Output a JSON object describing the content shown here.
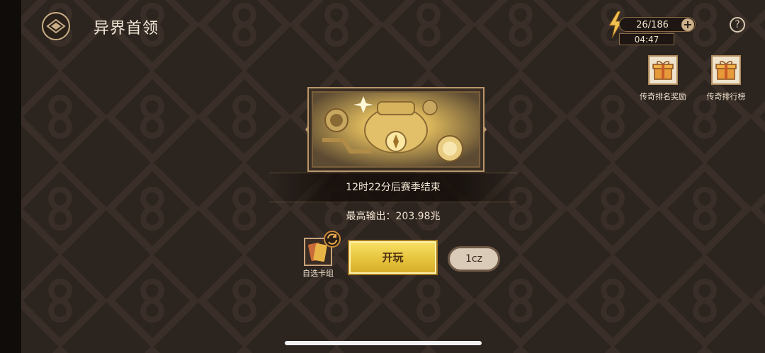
{
  "header": {
    "title": "异界首领"
  },
  "energy": {
    "count": "26/186",
    "timer": "04:47",
    "plus_icon": "+"
  },
  "help": {
    "icon": "?"
  },
  "side_buttons": [
    {
      "label": "传奇排名奖励",
      "icon": "gift-icon"
    },
    {
      "label": "传奇排行榜",
      "icon": "gift-icon"
    }
  ],
  "season": {
    "countdown": "12时22分后赛季结束"
  },
  "best_output": {
    "text": "最高输出：203.98兆"
  },
  "deck": {
    "label": "自选卡组"
  },
  "actions": {
    "play_label": "开玩",
    "cz_label": "1cz"
  },
  "colors": {
    "background": "#2c241f",
    "gold": "#e6c43c",
    "frame": "#b9976a"
  }
}
